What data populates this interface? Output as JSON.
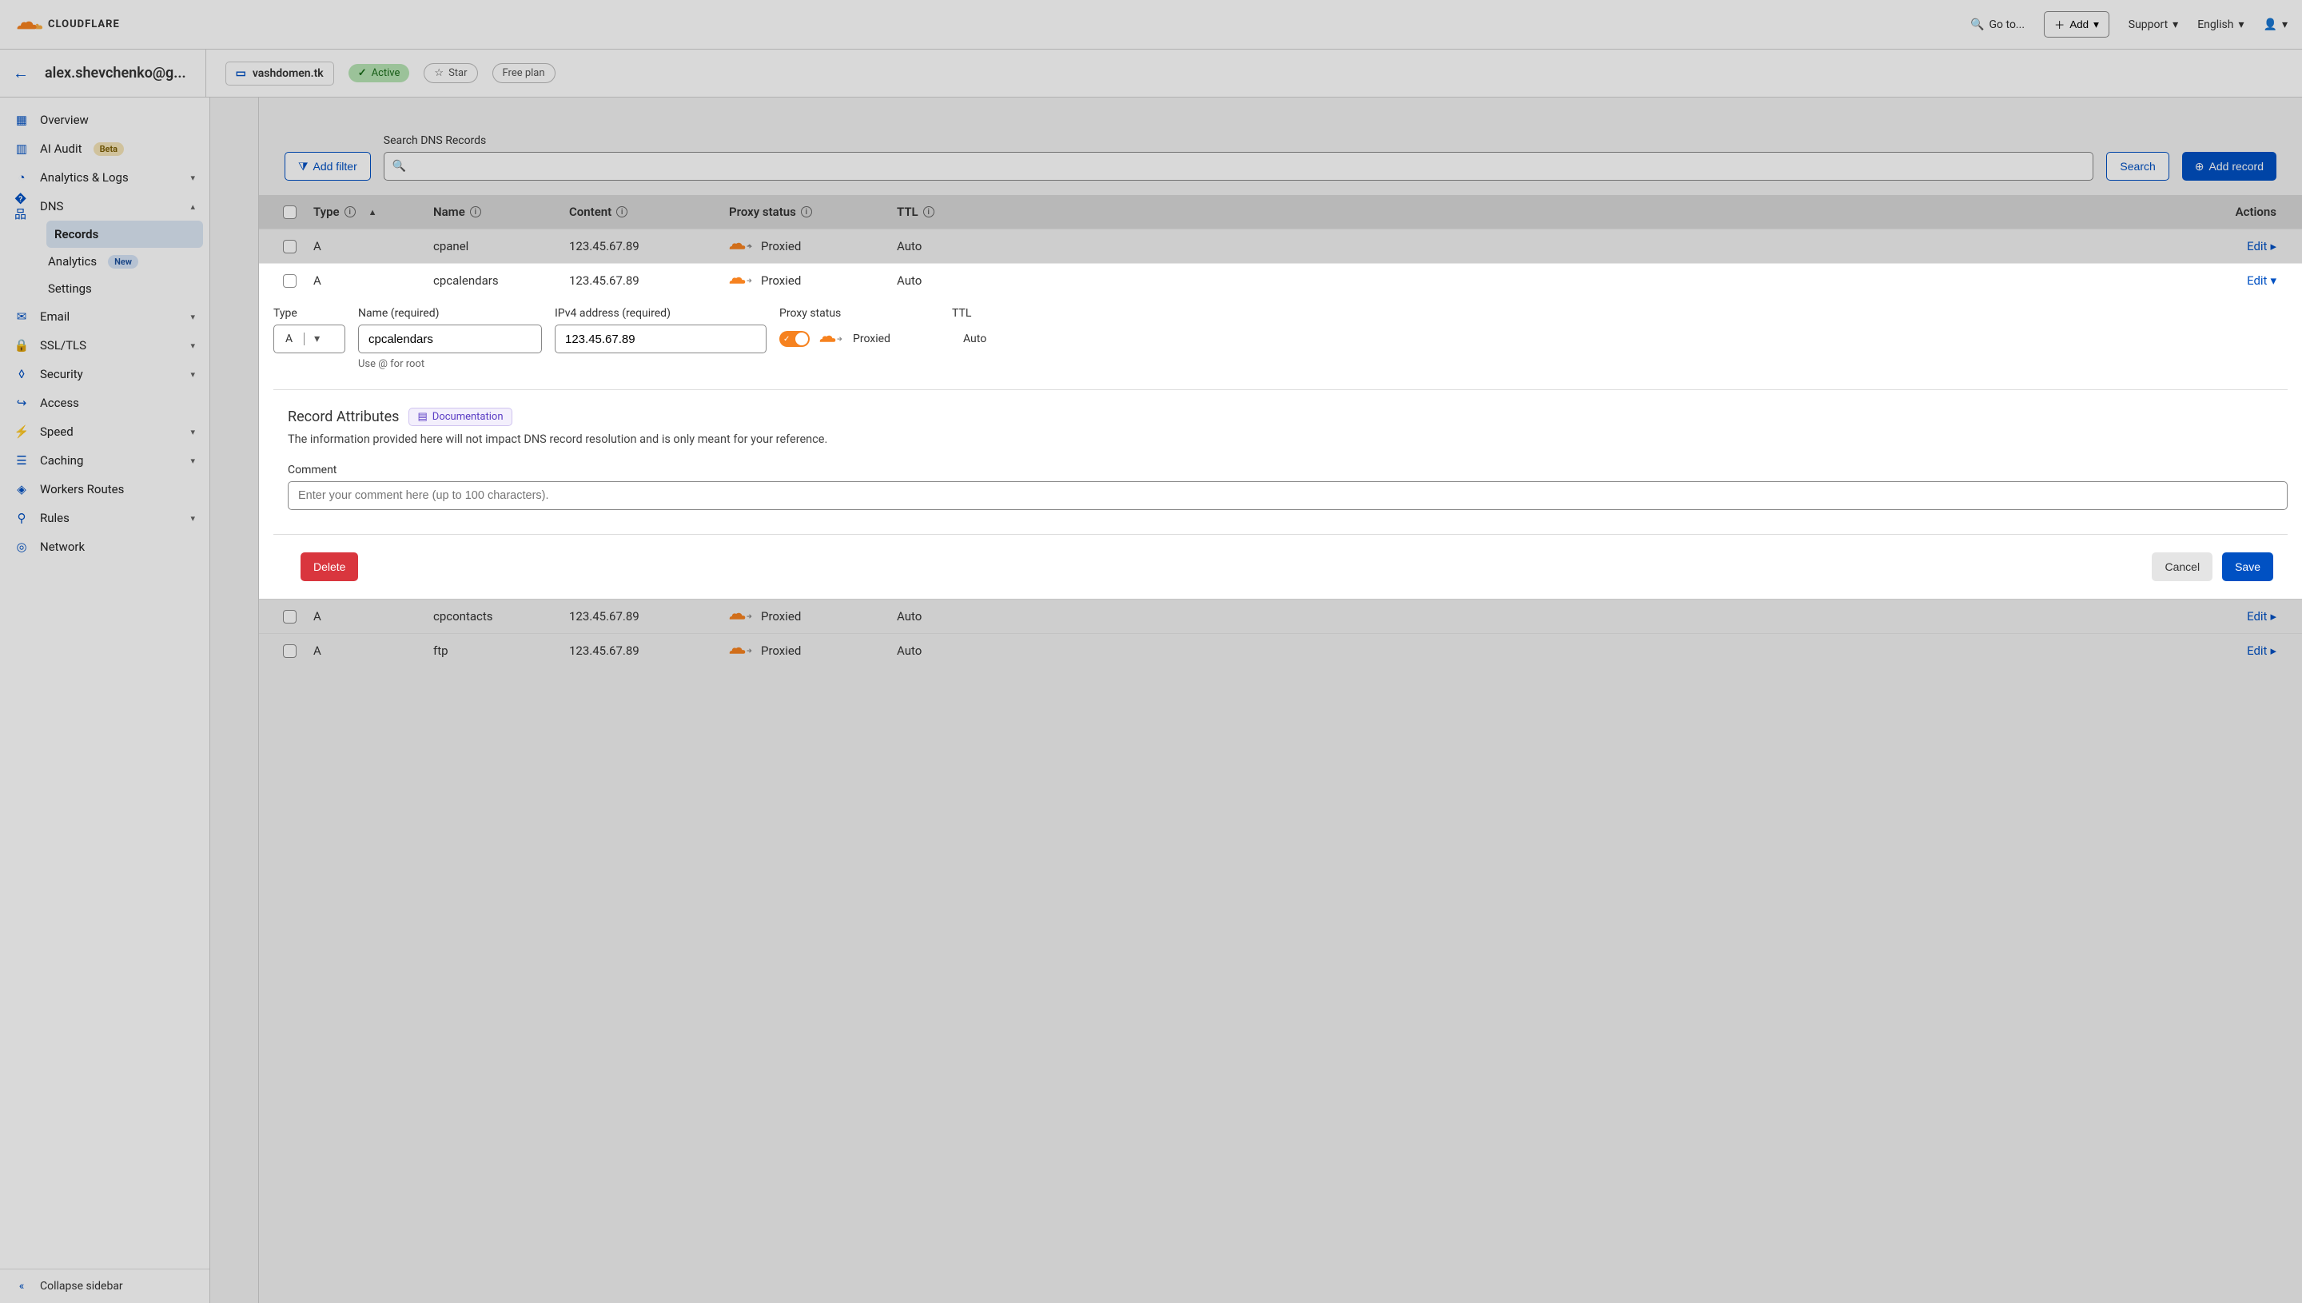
{
  "header": {
    "goto": "Go to...",
    "add": "Add",
    "support": "Support",
    "language": "English"
  },
  "secondBar": {
    "account": "alex.shevchenko@g...",
    "domain": "vashdomen.tk",
    "status": "Active",
    "star": "Star",
    "plan": "Free plan"
  },
  "sidebar": {
    "overview": "Overview",
    "ai_audit": "AI Audit",
    "ai_beta": "Beta",
    "analytics": "Analytics & Logs",
    "dns": "DNS",
    "dns_records": "Records",
    "dns_analytics": "Analytics",
    "dns_new": "New",
    "dns_settings": "Settings",
    "email": "Email",
    "ssl": "SSL/TLS",
    "security": "Security",
    "access": "Access",
    "speed": "Speed",
    "caching": "Caching",
    "workers": "Workers Routes",
    "rules": "Rules",
    "network": "Network",
    "collapse": "Collapse sidebar"
  },
  "toolbar": {
    "add_filter": "Add filter",
    "search_label": "Search DNS Records",
    "search_btn": "Search",
    "add_record": "Add record"
  },
  "columns": {
    "type": "Type",
    "name": "Name",
    "content": "Content",
    "proxy": "Proxy status",
    "ttl": "TTL",
    "actions": "Actions"
  },
  "rows": [
    {
      "type": "A",
      "name": "cpanel",
      "content": "123.45.67.89",
      "proxy": "Proxied",
      "ttl": "Auto",
      "edit": "Edit"
    },
    {
      "type": "A",
      "name": "cpcalendars",
      "content": "123.45.67.89",
      "proxy": "Proxied",
      "ttl": "Auto",
      "edit": "Edit"
    },
    {
      "type": "A",
      "name": "cpcontacts",
      "content": "123.45.67.89",
      "proxy": "Proxied",
      "ttl": "Auto",
      "edit": "Edit"
    },
    {
      "type": "A",
      "name": "ftp",
      "content": "123.45.67.89",
      "proxy": "Proxied",
      "ttl": "Auto",
      "edit": "Edit"
    }
  ],
  "editor": {
    "type_label": "Type",
    "type_value": "A",
    "name_label": "Name (required)",
    "name_value": "cpcalendars",
    "name_hint": "Use @ for root",
    "ip_label": "IPv4 address (required)",
    "ip_value": "123.45.67.89",
    "proxy_label": "Proxy status",
    "proxy_value": "Proxied",
    "ttl_label": "TTL",
    "ttl_value": "Auto",
    "attrs_title": "Record Attributes",
    "doc": "Documentation",
    "attrs_desc": "The information provided here will not impact DNS record resolution and is only meant for your reference.",
    "comment_label": "Comment",
    "comment_placeholder": "Enter your comment here (up to 100 characters).",
    "delete": "Delete",
    "cancel": "Cancel",
    "save": "Save"
  }
}
